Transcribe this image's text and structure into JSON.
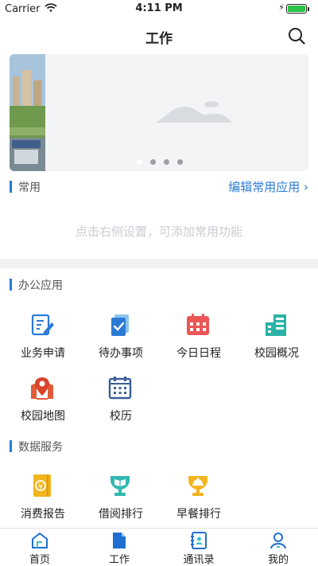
{
  "status_bar": {
    "carrier": "Carrier",
    "time": "4:11 PM"
  },
  "nav": {
    "title": "工作"
  },
  "banner": {
    "pages": 4,
    "active_page": 1
  },
  "common": {
    "title": "常用",
    "edit_link": "编辑常用应用",
    "hint": "点击右侧设置，可添加常用功能"
  },
  "office": {
    "title": "办公应用",
    "items": [
      {
        "label": "业务申请",
        "icon": "form-edit-icon"
      },
      {
        "label": "待办事项",
        "icon": "todo-check-icon"
      },
      {
        "label": "今日日程",
        "icon": "calendar-icon"
      },
      {
        "label": "校园概况",
        "icon": "building-icon"
      },
      {
        "label": "校园地图",
        "icon": "map-pin-icon"
      },
      {
        "label": "校历",
        "icon": "school-calendar-icon"
      }
    ]
  },
  "data_service": {
    "title": "数据服务",
    "items": [
      {
        "label": "消费报告",
        "icon": "spending-report-icon"
      },
      {
        "label": "借阅排行",
        "icon": "book-trophy-icon"
      },
      {
        "label": "早餐排行",
        "icon": "meal-trophy-icon"
      }
    ]
  },
  "tabbar": {
    "items": [
      {
        "label": "首页",
        "icon": "home-icon"
      },
      {
        "label": "工作",
        "icon": "document-icon",
        "active": true
      },
      {
        "label": "通讯录",
        "icon": "contacts-icon"
      },
      {
        "label": "我的",
        "icon": "profile-icon"
      }
    ]
  },
  "colors": {
    "accent": "#2a7bd6",
    "tab_active": "#1f6fd1"
  }
}
